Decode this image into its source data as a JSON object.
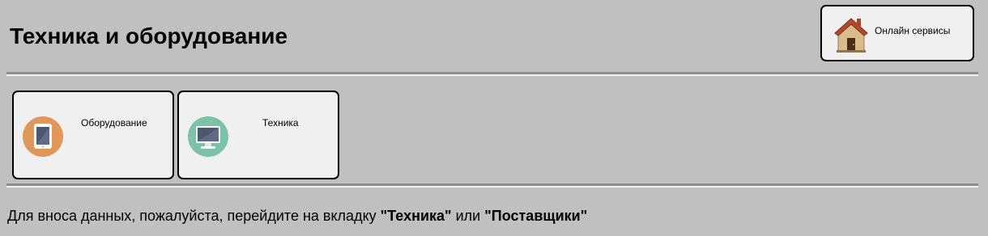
{
  "header": {
    "title": "Техника и оборудование",
    "home_button": {
      "label": "Онлайн сервисы",
      "icon": "house-icon"
    }
  },
  "tiles": [
    {
      "label": "Оборудование",
      "icon": "tablet-icon",
      "icon_color": "#e0985a"
    },
    {
      "label": "Техника",
      "icon": "monitor-icon",
      "icon_color": "#7cc2a8"
    }
  ],
  "info": {
    "before": "Для вноса данных, пожалуйста, перейдите на вкладку",
    "tab_technique": "\"Техника\"",
    "connector": "или",
    "tab_suppliers": "\"Поставщики\""
  },
  "colors": {
    "background": "#c0c0c0",
    "tile_background": "#f0f0f0",
    "border": "#000000"
  }
}
